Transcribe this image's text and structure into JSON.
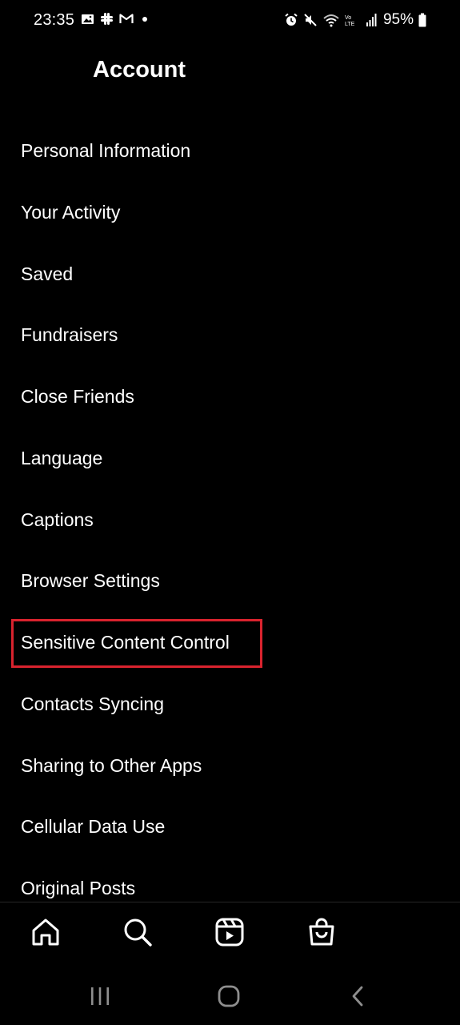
{
  "status_bar": {
    "time": "23:35",
    "battery": "95%",
    "left_icons": [
      "gallery-icon",
      "slack-icon",
      "gmail-icon",
      "dot-icon"
    ],
    "right_icons": [
      "alarm-icon",
      "mute-icon",
      "wifi-icon",
      "volte-icon",
      "signal-icon",
      "battery-icon"
    ]
  },
  "header": {
    "title": "Account"
  },
  "menu": {
    "items": [
      {
        "label": "Personal Information"
      },
      {
        "label": "Your Activity"
      },
      {
        "label": "Saved"
      },
      {
        "label": "Fundraisers"
      },
      {
        "label": "Close Friends"
      },
      {
        "label": "Language"
      },
      {
        "label": "Captions"
      },
      {
        "label": "Browser Settings"
      },
      {
        "label": "Sensitive Content Control",
        "highlighted": true
      },
      {
        "label": "Contacts Syncing"
      },
      {
        "label": "Sharing to Other Apps"
      },
      {
        "label": "Cellular Data Use"
      },
      {
        "label": "Original Posts"
      }
    ]
  },
  "tab_bar": {
    "tabs": [
      {
        "icon": "home-icon"
      },
      {
        "icon": "search-icon"
      },
      {
        "icon": "reels-icon"
      },
      {
        "icon": "shop-icon"
      }
    ]
  },
  "nav_bar": {
    "buttons": [
      {
        "icon": "recent-apps-icon"
      },
      {
        "icon": "home-circle-icon"
      },
      {
        "icon": "back-icon"
      }
    ]
  },
  "colors": {
    "background": "#000000",
    "text": "#ffffff",
    "highlight": "#d9232e",
    "divider": "#262626"
  }
}
